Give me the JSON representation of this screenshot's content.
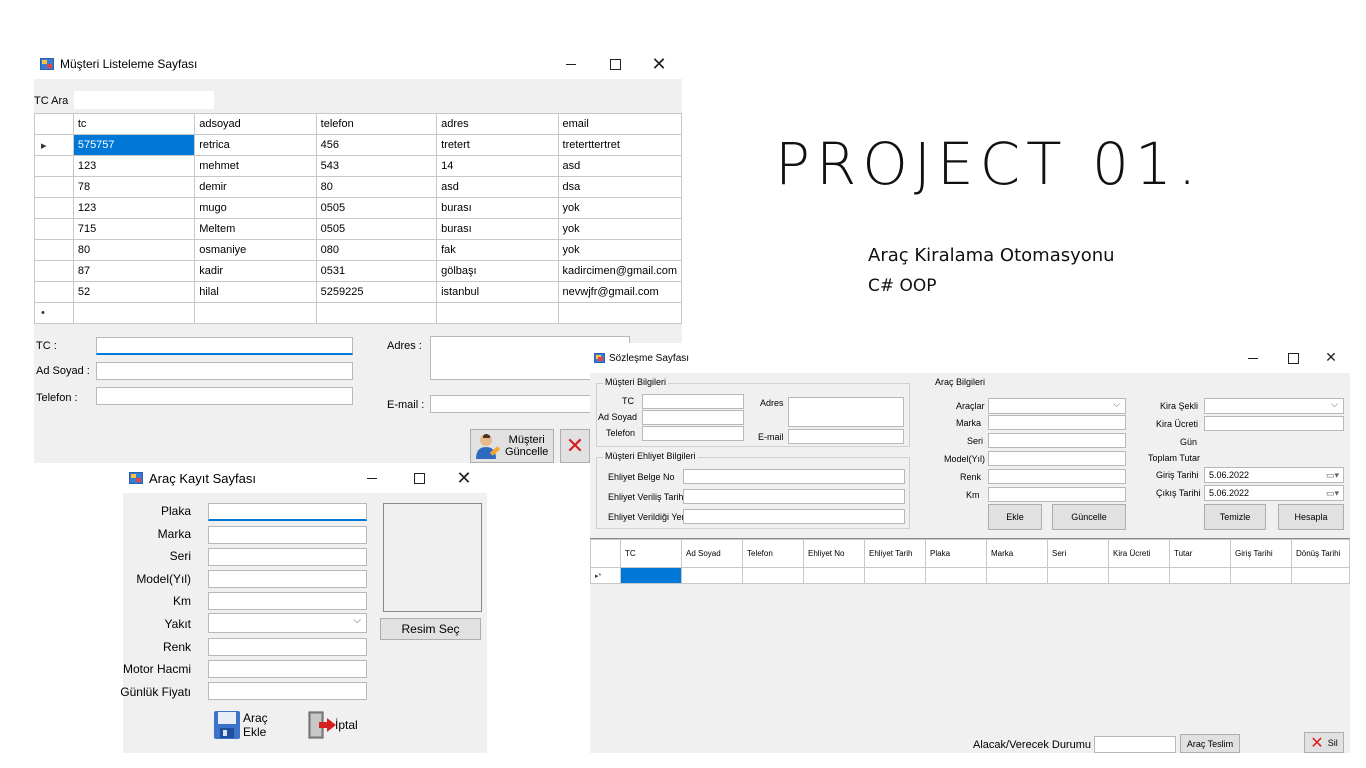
{
  "musteri": {
    "title": "Müşteri Listeleme Sayfası",
    "tc_ara_label": "TC Ara",
    "columns": [
      "tc",
      "adsoyad",
      "telefon",
      "adres",
      "email"
    ],
    "rows": [
      [
        "575757",
        "retrica",
        "456",
        "tretert",
        "treterttertret"
      ],
      [
        "123",
        "mehmet",
        "543",
        "14",
        "asd"
      ],
      [
        "78",
        "demir",
        "80",
        "asd",
        "dsa"
      ],
      [
        "123",
        "mugo",
        "0505",
        "burası",
        "yok"
      ],
      [
        "715",
        "Meltem",
        "0505",
        "burası",
        "yok"
      ],
      [
        "80",
        "osmaniye",
        "080",
        "fak",
        "yok"
      ],
      [
        "87",
        "kadir",
        "0531",
        "gölbaşı",
        "kadircimen@gmail.com"
      ],
      [
        "52",
        "hilal",
        "5259225",
        "istanbul",
        "nevwjfr@gmail.com"
      ]
    ],
    "current_marker": "▸",
    "new_marker": "•",
    "tc_label": "TC :",
    "adsoyad_label": "Ad Soyad :",
    "telefon_label": "Telefon :",
    "adres_label": "Adres :",
    "email_label": "E-mail :",
    "guncelle_label_1": "Müşteri",
    "guncelle_label_2": "Güncelle"
  },
  "project": {
    "heading": "PROJECT 01.",
    "line1": "Araç Kiralama Otomasyonu",
    "line2": "C# OOP"
  },
  "arac": {
    "title": "Araç  Kayıt Sayfası",
    "labels": [
      "Plaka",
      "Marka",
      "Seri",
      "Model(Yıl)",
      "Km",
      "Yakıt",
      "Renk",
      "Motor Hacmi",
      "Günlük Fiyatı"
    ],
    "resim_sec": "Resim Seç",
    "arac_ekle": "Araç Ekle",
    "iptal": "İptal"
  },
  "sozlesme": {
    "title": "Sözleşme Sayfası",
    "musteri_bilgileri": "Müşteri Bilgileri",
    "tc": "TC",
    "ad_soyad": "Ad Soyad",
    "telefon": "Telefon",
    "adres": "Adres",
    "email": "E-mail",
    "ehliyet_bilgileri": "Müşteri Ehliyet Bilgileri",
    "ehliyet_belge_no": "Ehliyet Belge No",
    "ehliyet_verilis_tarihi": "Ehliyet Veriliş Tarihi",
    "ehliyet_verildigi_yer": "Ehliyet Verildiği Yer",
    "arac_bilgileri": "Araç Bilgileri",
    "araclar": "Araçlar",
    "marka": "Marka",
    "seri": "Seri",
    "model": "Model(Yıl)",
    "renk": "Renk",
    "km": "Km",
    "ekle": "Ekle",
    "guncelle": "Güncelle",
    "kira_sekli": "Kira Şekli",
    "kira_ucreti": "Kira Ücreti",
    "gun": "Gün",
    "toplam_tutar": "Toplam Tutar",
    "giris_tarihi": "Giriş Tarihi",
    "cikis_tarihi": "Çıkış Tarihi",
    "giris_value": "5.06.2022",
    "cikis_value": "5.06.2022",
    "temizle": "Temizle",
    "hesapla": "Hesapla",
    "columns": [
      "TC",
      "Ad Soyad",
      "Telefon",
      "Ehliyet No",
      "Ehliyet Tarih",
      "Plaka",
      "Marka",
      "Seri",
      "Kira Ücreti",
      "Tutar",
      "Giriş Tarihi",
      "Dönüş Tarihi"
    ],
    "row_marker": "▸*",
    "alacak_verecek": "Alacak/Verecek Durumu",
    "arac_teslim": "Araç Teslim",
    "sil": "Sil"
  }
}
